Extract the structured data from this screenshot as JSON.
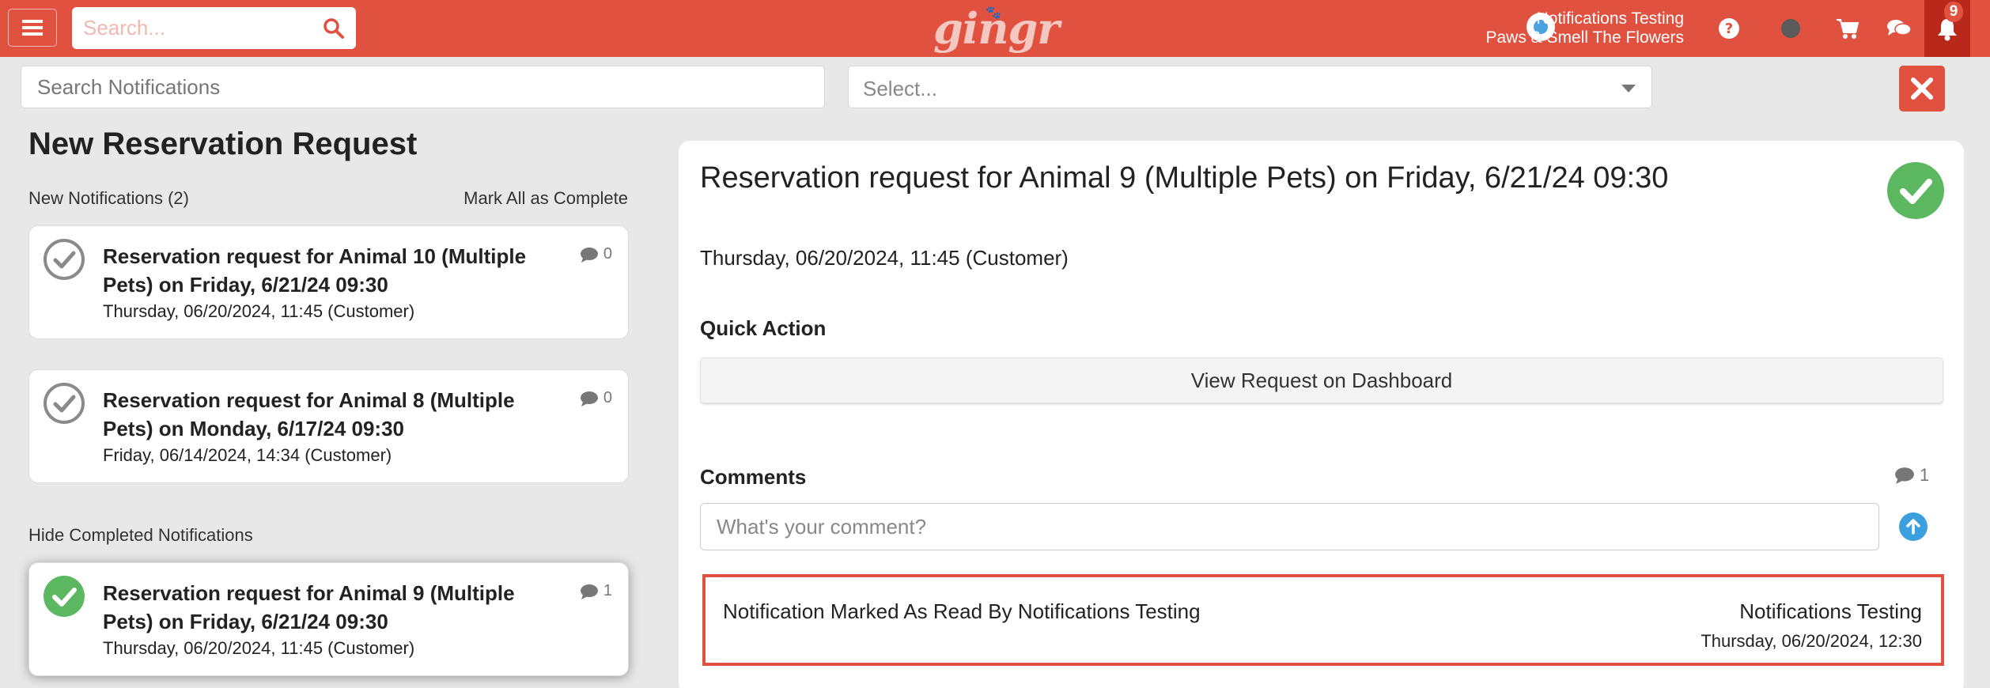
{
  "topbar": {
    "search_placeholder": "Search...",
    "logo": "gingr",
    "user_name": "Notifications Testing",
    "location": "Paws & Smell The Flowers",
    "notification_count": "9",
    "brand_color": "#e05140"
  },
  "filters": {
    "search_placeholder": "Search Notifications",
    "select_placeholder": "Select..."
  },
  "left": {
    "page_title": "New Reservation Request",
    "new_label": "New Notifications (2)",
    "mark_all_label": "Mark All as Complete",
    "hide_completed_label": "Hide Completed Notifications",
    "cards": [
      {
        "title": "Reservation request for Animal 10 (Multiple Pets) on Friday, 6/21/24 09:30",
        "meta": "Thursday, 06/20/2024, 11:45 (Customer)",
        "comments": "0",
        "completed": false
      },
      {
        "title": "Reservation request for Animal 8 (Multiple Pets) on Monday, 6/17/24 09:30",
        "meta": "Friday, 06/14/2024, 14:34 (Customer)",
        "comments": "0",
        "completed": false
      },
      {
        "title": "Reservation request for Animal 9 (Multiple Pets) on Friday, 6/21/24 09:30",
        "meta": "Thursday, 06/20/2024, 11:45 (Customer)",
        "comments": "1",
        "completed": true
      }
    ]
  },
  "detail": {
    "title": "Reservation request for Animal 9 (Multiple Pets) on Friday, 6/21/24 09:30",
    "date": "Thursday, 06/20/2024, 11:45 (Customer)",
    "quick_action_label": "Quick Action",
    "dashboard_button": "View Request on Dashboard",
    "comments_label": "Comments",
    "comments_count": "1",
    "comment_placeholder": "What's your comment?",
    "comment": {
      "text": "Notification Marked As Read By Notifications Testing",
      "author": "Notifications Testing",
      "time": "Thursday, 06/20/2024, 12:30"
    }
  }
}
